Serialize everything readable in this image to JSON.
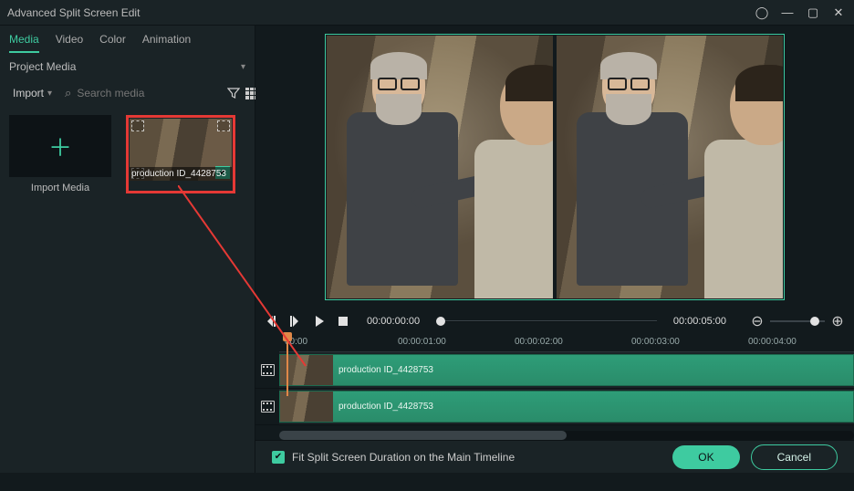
{
  "title": "Advanced Split Screen Edit",
  "tabs": {
    "media": "Media",
    "video": "Video",
    "color": "Color",
    "animation": "Animation"
  },
  "project_media_label": "Project Media",
  "import_label": "Import",
  "search_placeholder": "Search media",
  "import_tile_label": "Import Media",
  "clip_name": "production ID_4428753",
  "playback": {
    "current": "00:00:00:00",
    "duration": "00:00:05:00"
  },
  "ruler": [
    "00:00",
    "00:00:01:00",
    "00:00:02:00",
    "00:00:03:00",
    "00:00:04:00"
  ],
  "track_clip": "production ID_4428753",
  "fit_label": "Fit Split Screen Duration on the Main Timeline",
  "buttons": {
    "ok": "OK",
    "cancel": "Cancel"
  }
}
